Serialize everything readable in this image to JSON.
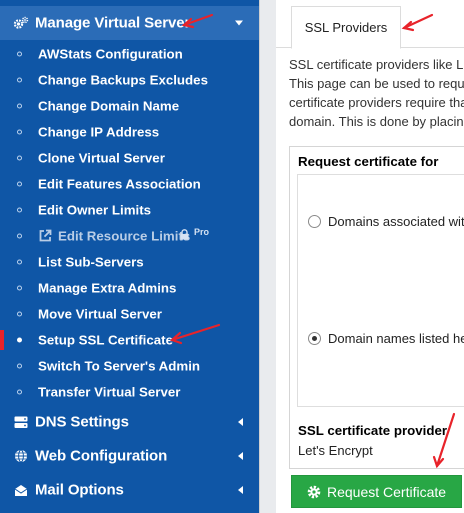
{
  "sidebar": {
    "sections_top": {
      "label": "Manage Virtual Server",
      "icon": "gears-icon"
    },
    "subitems": [
      {
        "label": "AWStats Configuration"
      },
      {
        "label": "Change Backups Excludes"
      },
      {
        "label": "Change Domain Name"
      },
      {
        "label": "Change IP Address"
      },
      {
        "label": "Clone Virtual Server"
      },
      {
        "label": "Edit Features Association"
      },
      {
        "label": "Edit Owner Limits"
      },
      {
        "label": "Edit Resource Limits",
        "badge": "Pro",
        "disabled": true
      },
      {
        "label": "List Sub-Servers"
      },
      {
        "label": "Manage Extra Admins"
      },
      {
        "label": "Move Virtual Server"
      },
      {
        "label": "Setup SSL Certificate",
        "active": true
      },
      {
        "label": "Switch To Server's Admin"
      },
      {
        "label": "Transfer Virtual Server"
      }
    ],
    "sections_bottom": [
      {
        "label": "DNS Settings",
        "icon": "server-icon"
      },
      {
        "label": "Web Configuration",
        "icon": "globe-icon"
      },
      {
        "label": "Mail Options",
        "icon": "envelope-icon"
      }
    ]
  },
  "main": {
    "tab": "SSL Providers",
    "description": [
      "SSL certificate providers like L",
      "This page can be used to requ",
      "certificate providers require tha",
      "domain. This is done by placin"
    ],
    "form": {
      "title": "Request certificate for",
      "option1": "Domains associated wit",
      "option2": "Domain names listed he",
      "selected": 2,
      "provider_label": "SSL certificate provider",
      "provider_value": "Let's Encrypt"
    },
    "request_button": "Request Certificate"
  },
  "colors": {
    "sidebar_bg": "#0f56a6",
    "sidebar_active_bg": "#2b6cb7",
    "active_marker": "#e8232a",
    "button_green": "#28a745",
    "annotation_arrow": "#e8232a"
  }
}
